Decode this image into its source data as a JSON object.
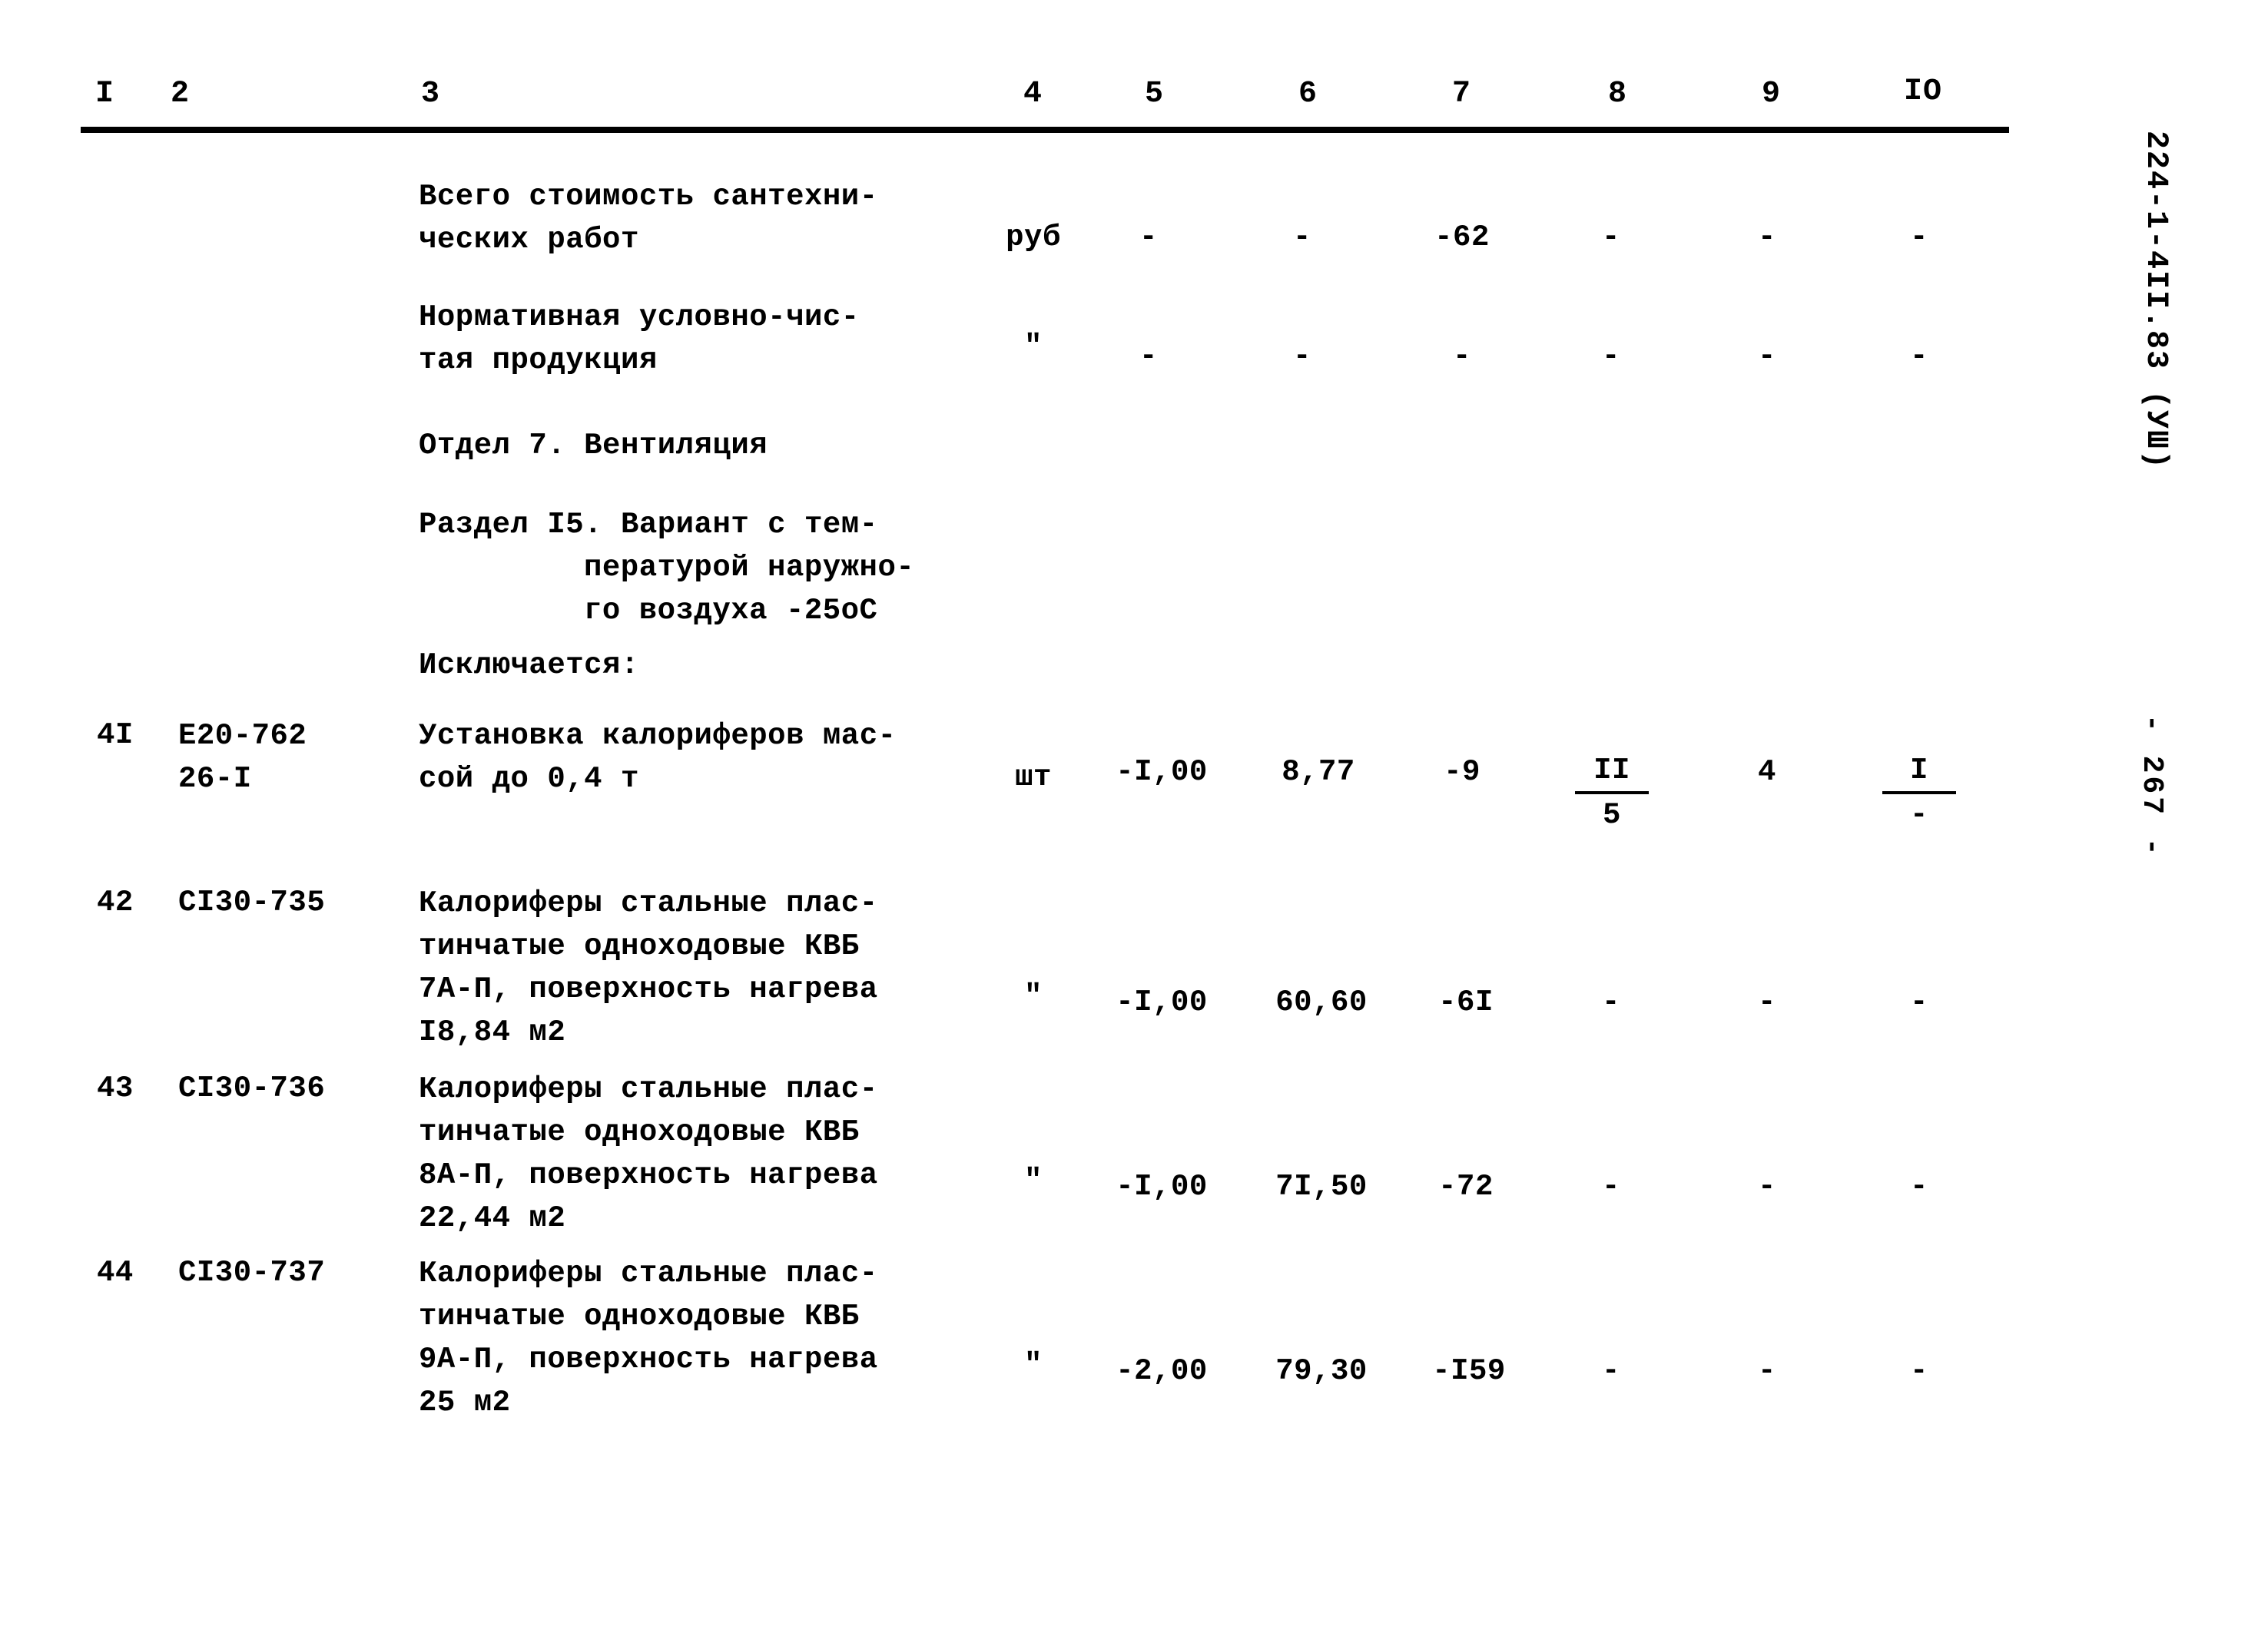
{
  "document": {
    "code_vertical": "224-1-4II.83 (УШ)",
    "page_number": "- 267 -"
  },
  "table": {
    "column_headers": [
      "I",
      "2",
      "3",
      "4",
      "5",
      "6",
      "7",
      "8",
      "9",
      "IO"
    ],
    "rows": [
      {
        "no": "",
        "code": "",
        "description": "Всего стоимость сантехни-\nческих работ",
        "unit": "руб",
        "c5": "-",
        "c6": "-",
        "c7": "-62",
        "c8": "-",
        "c9": "-",
        "c10": "-"
      },
      {
        "no": "",
        "code": "",
        "description": "Нормативная условно-чис-\nтая продукция",
        "unit": "\"",
        "c5": "-",
        "c6": "-",
        "c7": "-",
        "c8": "-",
        "c9": "-",
        "c10": "-"
      },
      {
        "no": "",
        "code": "",
        "description": "Отдел 7. Вентиляция",
        "unit": "",
        "c5": "",
        "c6": "",
        "c7": "",
        "c8": "",
        "c9": "",
        "c10": ""
      },
      {
        "no": "",
        "code": "",
        "description": "Раздел I5. Вариант с тем-",
        "description_indent": "пературой наружно-\nго воздуха -25оС",
        "unit": "",
        "c5": "",
        "c6": "",
        "c7": "",
        "c8": "",
        "c9": "",
        "c10": ""
      },
      {
        "no": "",
        "code": "",
        "description": "Исключается:",
        "unit": "",
        "c5": "",
        "c6": "",
        "c7": "",
        "c8": "",
        "c9": "",
        "c10": ""
      },
      {
        "no": "4I",
        "code": "Е20-762\n26-I",
        "description": "Установка калориферов мас-\nсой до 0,4 т",
        "unit": "шт",
        "c5": "-I,00",
        "c6": "8,77",
        "c7": "-9",
        "c8_top": "II",
        "c8_bottom": "5",
        "c9": "4",
        "c10_top": "I",
        "c10_bottom": "-"
      },
      {
        "no": "42",
        "code": "СI30-735",
        "description": "Калориферы стальные плас-\nтинчатые одноходовые КВБ\n7А-П, поверхность нагрева\nI8,84 м2",
        "unit": "\"",
        "c5": "-I,00",
        "c6": "60,60",
        "c7": "-6I",
        "c8": "-",
        "c9": "-",
        "c10": "-"
      },
      {
        "no": "43",
        "code": "СI30-736",
        "description": "Калориферы стальные плас-\nтинчатые одноходовые КВБ\n8А-П, поверхность нагрева\n22,44 м2",
        "unit": "\"",
        "c5": "-I,00",
        "c6": "7I,50",
        "c7": "-72",
        "c8": "-",
        "c9": "-",
        "c10": "-"
      },
      {
        "no": "44",
        "code": "СI30-737",
        "description": "Калориферы стальные плас-\nтинчатые одноходовые КВБ\n9А-П, поверхность нагрева\n25 м2",
        "unit": "\"",
        "c5": "-2,00",
        "c6": "79,30",
        "c7": "-I59",
        "c8": "-",
        "c9": "-",
        "c10": "-"
      }
    ]
  }
}
